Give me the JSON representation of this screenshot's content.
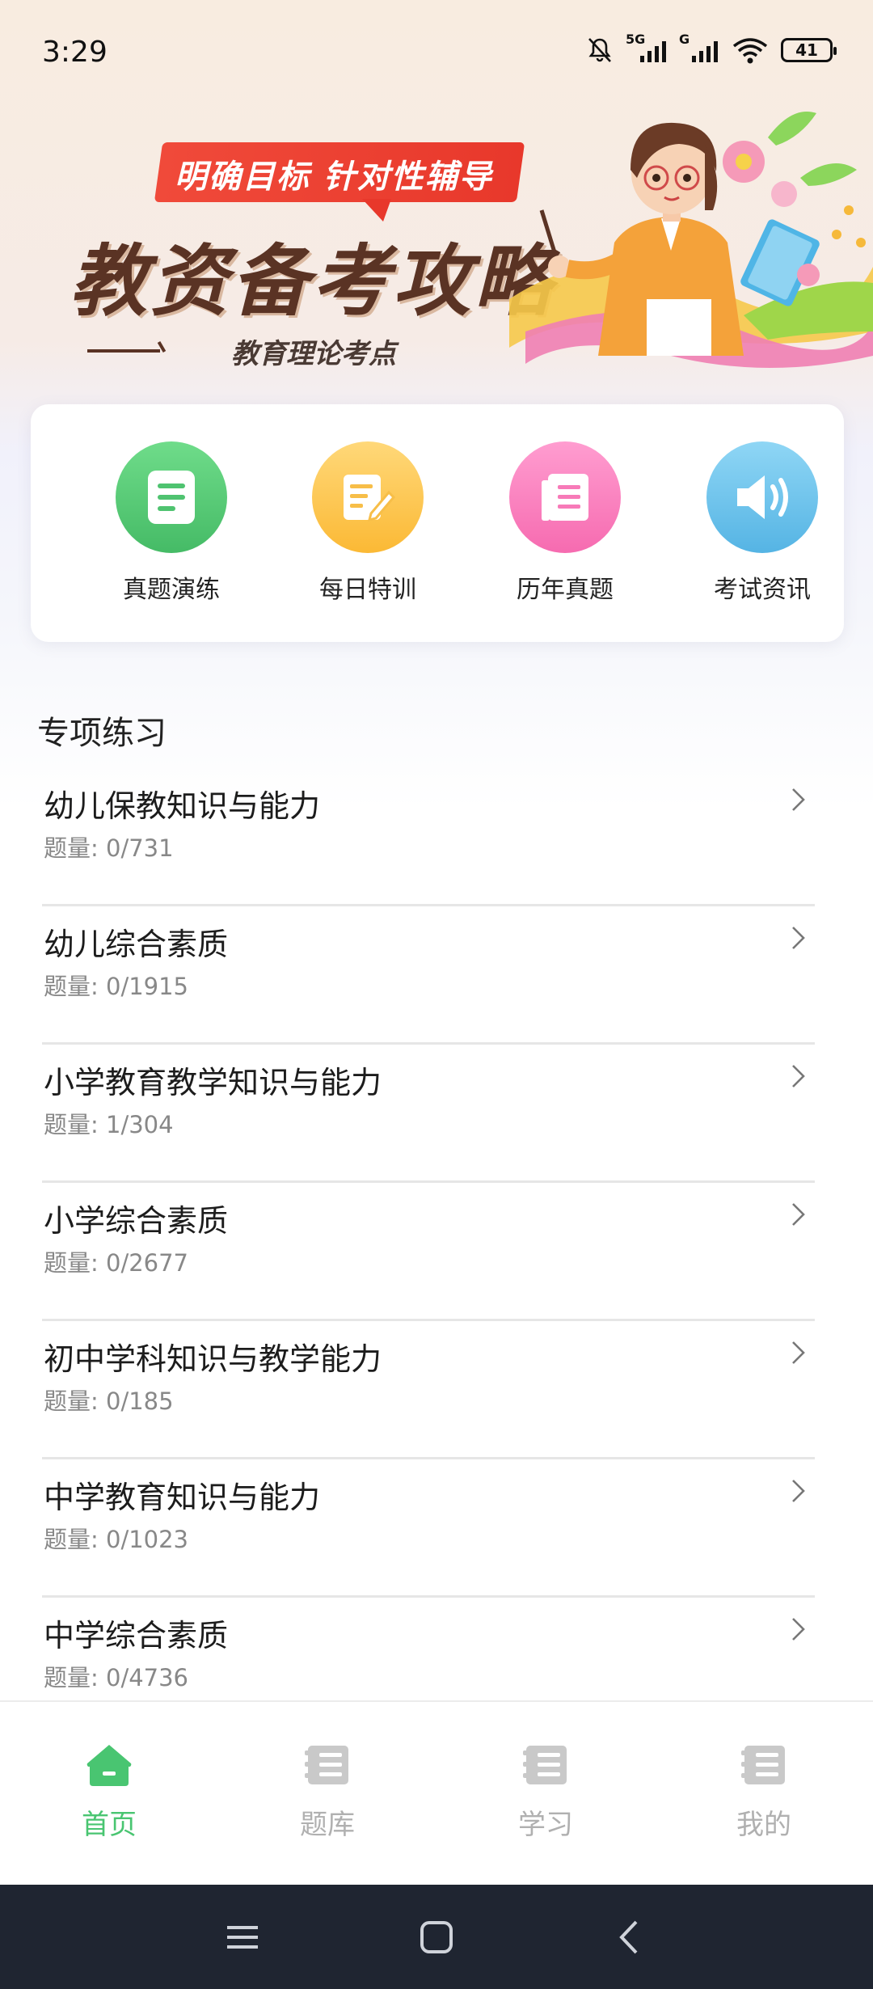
{
  "status_bar": {
    "time": "3:29",
    "net1": "5G",
    "net2": "G",
    "battery": "41"
  },
  "banner": {
    "tag": "明确目标  针对性辅导",
    "title": "教资备考攻略",
    "subtitle": "教育理论考点"
  },
  "quick_actions": [
    {
      "label": "真题演练",
      "icon": "document-icon",
      "color": "#5dce79"
    },
    {
      "label": "每日特训",
      "icon": "edit-note-icon",
      "color": "#ffc95e"
    },
    {
      "label": "历年真题",
      "icon": "book-icon",
      "color": "#ff7fbe"
    },
    {
      "label": "考试资讯",
      "icon": "speaker-icon",
      "color": "#6fc2ea"
    }
  ],
  "section": {
    "title": "专项练习"
  },
  "practice_list": [
    {
      "title": "幼儿保教知识与能力",
      "count": "题量: 0/731"
    },
    {
      "title": "幼儿综合素质",
      "count": "题量: 0/1915"
    },
    {
      "title": "小学教育教学知识与能力",
      "count": "题量: 1/304"
    },
    {
      "title": "小学综合素质",
      "count": "题量: 0/2677"
    },
    {
      "title": "初中学科知识与教学能力",
      "count": "题量: 0/185"
    },
    {
      "title": "中学教育知识与能力",
      "count": "题量: 0/1023"
    },
    {
      "title": "中学综合素质",
      "count": "题量: 0/4736"
    }
  ],
  "tabs": [
    {
      "label": "首页",
      "active": true
    },
    {
      "label": "题库"
    },
    {
      "label": "学习"
    },
    {
      "label": "我的"
    }
  ],
  "colors": {
    "accent": "#49c571",
    "inactive": "#b0b0b0",
    "nav_bar": "#1f2531"
  }
}
